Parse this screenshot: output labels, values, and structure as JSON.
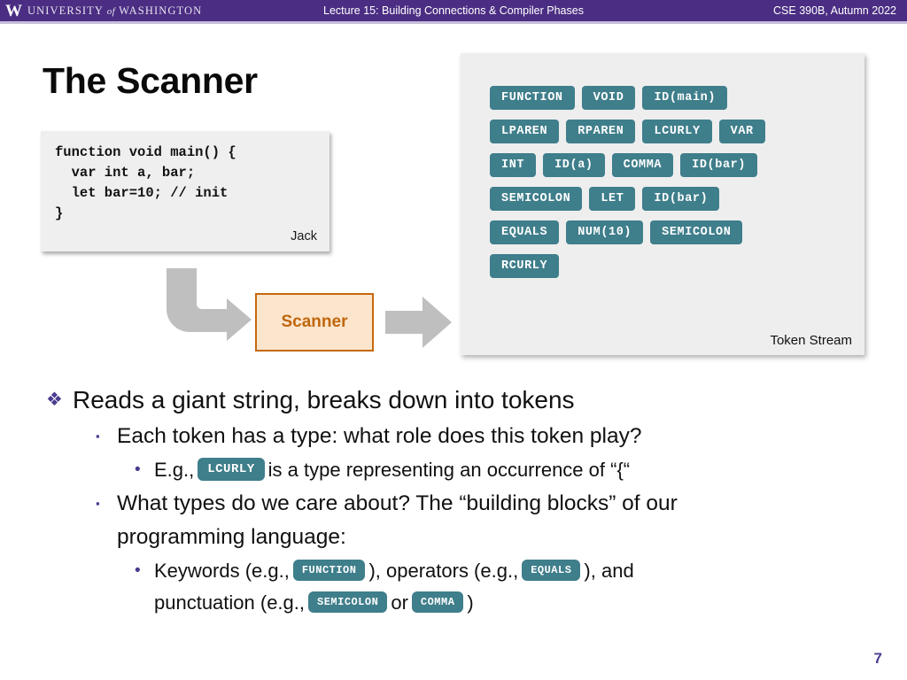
{
  "header": {
    "brand_logo": "uw-w-logo",
    "brand_name_part1": "UNIVERSITY",
    "brand_name_of": "of",
    "brand_name_part2": "WASHINGTON",
    "lecture_title": "Lecture 15: Building Connections & Compiler Phases",
    "course": "CSE 390B, Autumn 2022",
    "bar_color": "#4b2e83",
    "underline_color": "#c6bed8"
  },
  "slide": {
    "title": "The Scanner",
    "page_number": "7"
  },
  "code_card": {
    "code": "function void main() {\n  var int a, bar;\n  let bar=10; // init\n}",
    "caption": "Jack"
  },
  "token_panel": {
    "caption": "Token Stream",
    "chip_color": "#3f7e8b",
    "rows": [
      [
        "FUNCTION",
        "VOID",
        "ID(main)"
      ],
      [
        "LPAREN",
        "RPAREN",
        "LCURLY",
        "VAR"
      ],
      [
        "INT",
        "ID(a)",
        "COMMA",
        "ID(bar)"
      ],
      [
        "SEMICOLON",
        "LET",
        "ID(bar)"
      ],
      [
        "EQUALS",
        "NUM(10)",
        "SEMICOLON"
      ],
      [
        "RCURLY"
      ]
    ]
  },
  "flow": {
    "scanner_label": "Scanner",
    "scanner_fill": "#fbe5cd",
    "scanner_border": "#c5690e",
    "scanner_text_color": "#c0660c",
    "arrow_color": "#bfbfbf"
  },
  "bullets": {
    "marker_diamond": "❖",
    "marker_square": "▪",
    "marker_dot": "•",
    "marker_color": "#4b3b8f",
    "level1_text": "Reads a giant string, breaks down into tokens",
    "level2a_text": "Each token has a type: what role does this token play?",
    "level3a_prefix": "E.g.,",
    "level3a_chip": "LCURLY",
    "level3a_suffix": "is a type representing an occurrence of “{“",
    "level2b_text": "What types do we care about? The “building blocks” of our",
    "level2b_text_line2": "programming language:",
    "level3b_seg1": "Keywords (e.g.,",
    "level3b_chip1": "FUNCTION",
    "level3b_seg2": "), operators (e.g.,",
    "level3b_chip2": "EQUALS",
    "level3b_seg3": "), and",
    "level3b_seg4": "punctuation (e.g.,",
    "level3b_chip3": "SEMICOLON",
    "level3b_seg5": "or",
    "level3b_chip4": "COMMA",
    "level3b_seg6": ")"
  }
}
